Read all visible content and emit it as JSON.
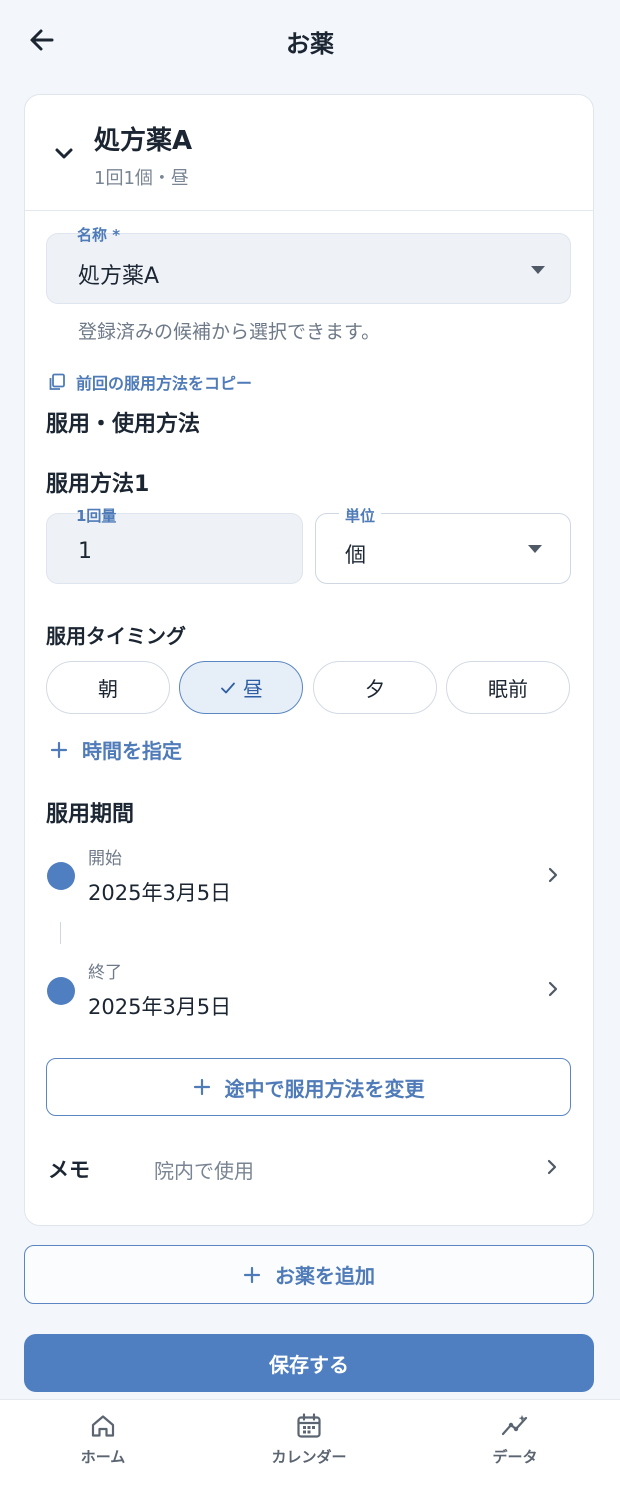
{
  "header": {
    "title": "お薬",
    "back_icon": "arrow-left-icon"
  },
  "medication": {
    "name": "処方薬A",
    "summary": "1回1個・昼",
    "name_field": {
      "label": "名称 *",
      "value": "処方薬A",
      "helper": "登録済みの候補から選択できます。"
    },
    "copy_link": "前回の服用方法をコピー",
    "usage_heading": "服用・使用方法",
    "method_heading": "服用方法1",
    "dose": {
      "label": "1回量",
      "value": "1"
    },
    "unit": {
      "label": "単位",
      "value": "個"
    },
    "timing_heading": "服用タイミング",
    "timing_options": [
      {
        "label": "朝",
        "selected": false
      },
      {
        "label": "昼",
        "selected": true
      },
      {
        "label": "夕",
        "selected": false
      },
      {
        "label": "眠前",
        "selected": false
      }
    ],
    "add_time": "時間を指定",
    "period_heading": "服用期間",
    "period": {
      "start_label": "開始",
      "start_date": "2025年3月5日",
      "end_label": "終了",
      "end_date": "2025年3月5日"
    },
    "change_method": "途中で服用方法を変更",
    "memo": {
      "label": "メモ",
      "value": "院内で使用"
    }
  },
  "add_medication": "お薬を追加",
  "save": "保存する",
  "bottom_nav": [
    {
      "label": "ホーム",
      "icon": "home-icon"
    },
    {
      "label": "カレンダー",
      "icon": "calendar-icon"
    },
    {
      "label": "データ",
      "icon": "chart-icon"
    }
  ],
  "colors": {
    "accent": "#4f7fc0",
    "accent_text": "#4f7bb8",
    "background": "#f3f6fa"
  }
}
